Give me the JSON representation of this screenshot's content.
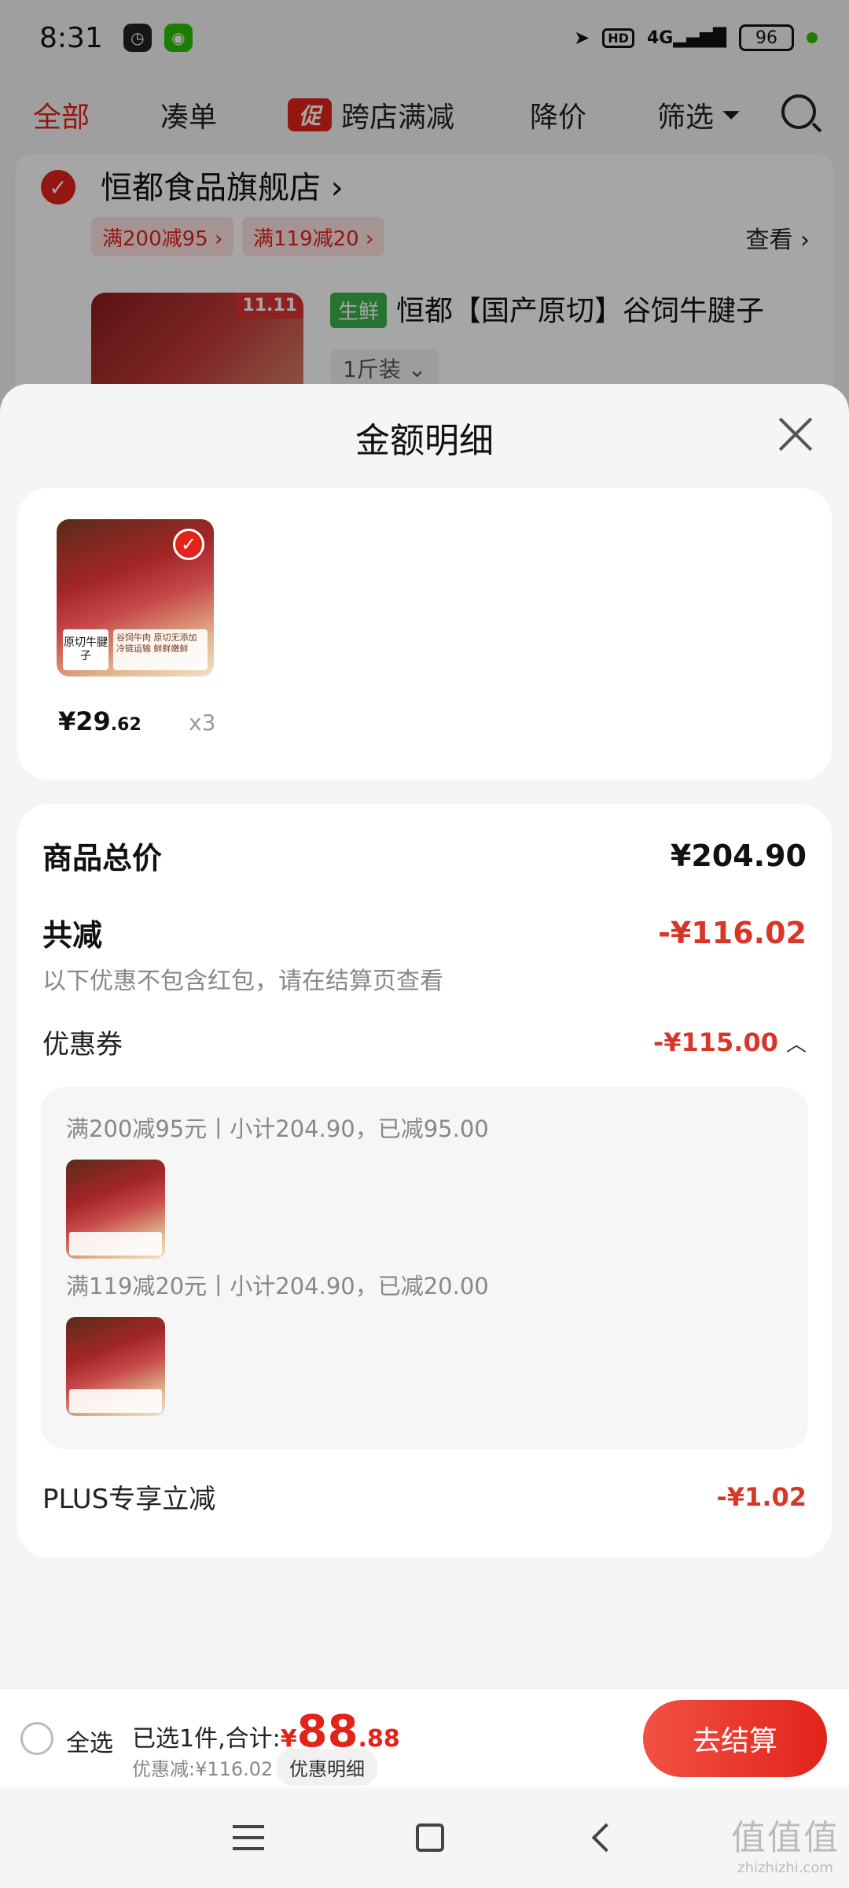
{
  "status_bar": {
    "time": "8:31",
    "hd": "HD",
    "network": "4G",
    "battery": "96"
  },
  "filter_bar": {
    "items": [
      "全部",
      "凑单",
      "跨店满减",
      "降价",
      "筛选"
    ],
    "promo_tag": "促"
  },
  "store": {
    "name": "恒都食品旗舰店 ›",
    "coupons": [
      "满200减95 ›",
      "满119减20 ›"
    ],
    "view": "查看 ›",
    "product_badge": "11.11",
    "fresh_tag": "生鲜",
    "product_title": "恒都【国产原切】谷饲牛腱子",
    "spec": "1斤装 ⌄"
  },
  "sheet": {
    "title": "金额明细",
    "item": {
      "price_symbol": "¥",
      "price_int": "29",
      "price_dec": ".62",
      "qty": "x3",
      "label": "原切牛腱子",
      "strip": "谷饲牛肉 原切无添加 冷链运输 鲜鲜嫩鲜"
    },
    "total_label": "商品总价",
    "total_value": "¥204.90",
    "reduce_label": "共减",
    "reduce_value": "-¥116.02",
    "note": "以下优惠不包含红包，请在结算页查看",
    "coupon_label": "优惠券",
    "coupon_value": "-¥115.00",
    "coupon_details": [
      "满200减95元丨小计204.90，已减95.00",
      "满119减20元丨小计204.90，已减20.00"
    ],
    "plus_label": "PLUS专享立减",
    "plus_value": "-¥1.02"
  },
  "checkout": {
    "select_all": "全选",
    "selected": "已选1件,合计:",
    "yen": "¥",
    "total_int": "88",
    "total_dec": ".88",
    "discount": "优惠减:¥116.02",
    "detail_pill": "优惠明细",
    "pay": "去结算"
  },
  "watermark": {
    "big": "值值值",
    "small": "zhizhizhi.com"
  }
}
